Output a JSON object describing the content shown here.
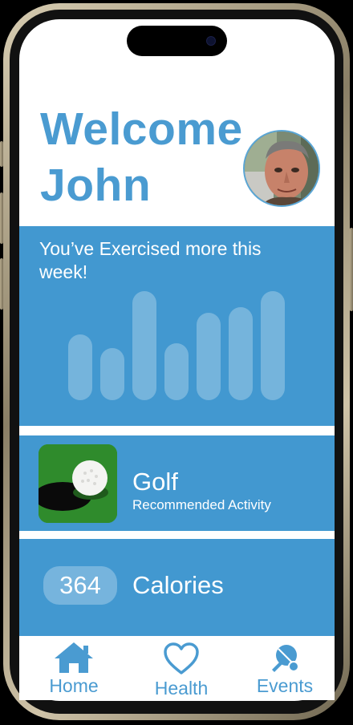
{
  "header": {
    "welcome_line1": "Welcome",
    "welcome_line2": "John"
  },
  "exercise": {
    "title": "You’ve Exercised more this week!",
    "bar_levels": [
      0.6,
      0.48,
      1.0,
      0.52,
      0.8,
      0.85,
      1.0
    ]
  },
  "recommended": {
    "activity": "Golf",
    "subtitle": "Recommended Activity"
  },
  "calories": {
    "value": "364",
    "label": "Calories"
  },
  "tabs": [
    {
      "label": "Home",
      "icon": "home-icon"
    },
    {
      "label": "Health",
      "icon": "heart-icon"
    },
    {
      "label": "Events",
      "icon": "ping-pong-icon"
    }
  ],
  "colors": {
    "accent": "#4298d0",
    "text_accent": "#4a9bd1"
  }
}
